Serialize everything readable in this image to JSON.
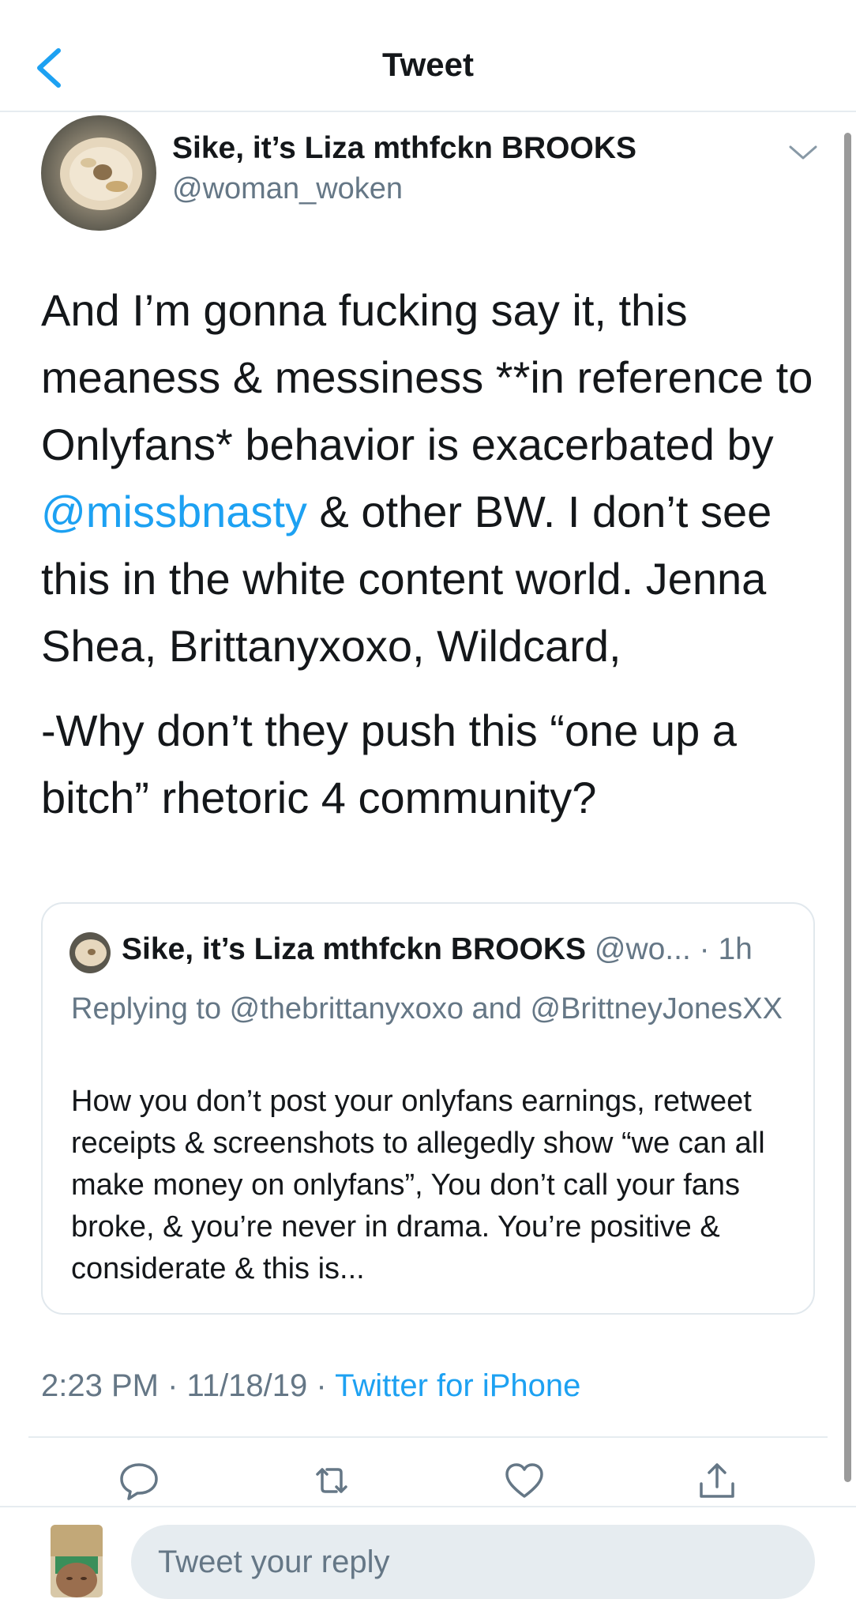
{
  "nav": {
    "title": "Tweet",
    "back_icon": "chevron-left-icon"
  },
  "author": {
    "name": "Sike, it’s Liza mthfckn BROOKS",
    "handle": "@woman_woken"
  },
  "tweet": {
    "text_part1": "And I’m gonna fucking say it, this meaness & messiness **in reference to Onlyfans* behavior is exacerbated by ",
    "mention": "@missbnasty",
    "text_part2": " & other BW. I don’t see this in the white content world. Jenna Shea, Brittanyxoxo, Wildcard,",
    "text_para2": "-Why don’t they push this “one up a bitch” rhetoric 4 community?"
  },
  "quoted_tweet": {
    "name": "Sike, it’s Liza mthfckn BROOKS",
    "handle": "@wo...",
    "time": "· 1h",
    "replying_to": "Replying to @thebrittanyxoxo and @BrittneyJonesXX",
    "text": "How you don’t post your onlyfans earnings, retweet receipts & screenshots to allegedly show “we can all make money on onlyfans”, You don’t call your fans broke, & you’re never in drama. You’re positive & considerate & this is..."
  },
  "meta": {
    "time": "2:23 PM",
    "date": "11/18/19",
    "separator": "·",
    "source": "Twitter for iPhone"
  },
  "actions": [
    "reply-icon",
    "retweet-icon",
    "like-icon",
    "share-icon"
  ],
  "reply": {
    "placeholder": "Tweet your reply"
  },
  "colors": {
    "accent": "#1da1f2",
    "secondary_text": "#657786",
    "border": "#e6ecf0",
    "text": "#14171a"
  }
}
